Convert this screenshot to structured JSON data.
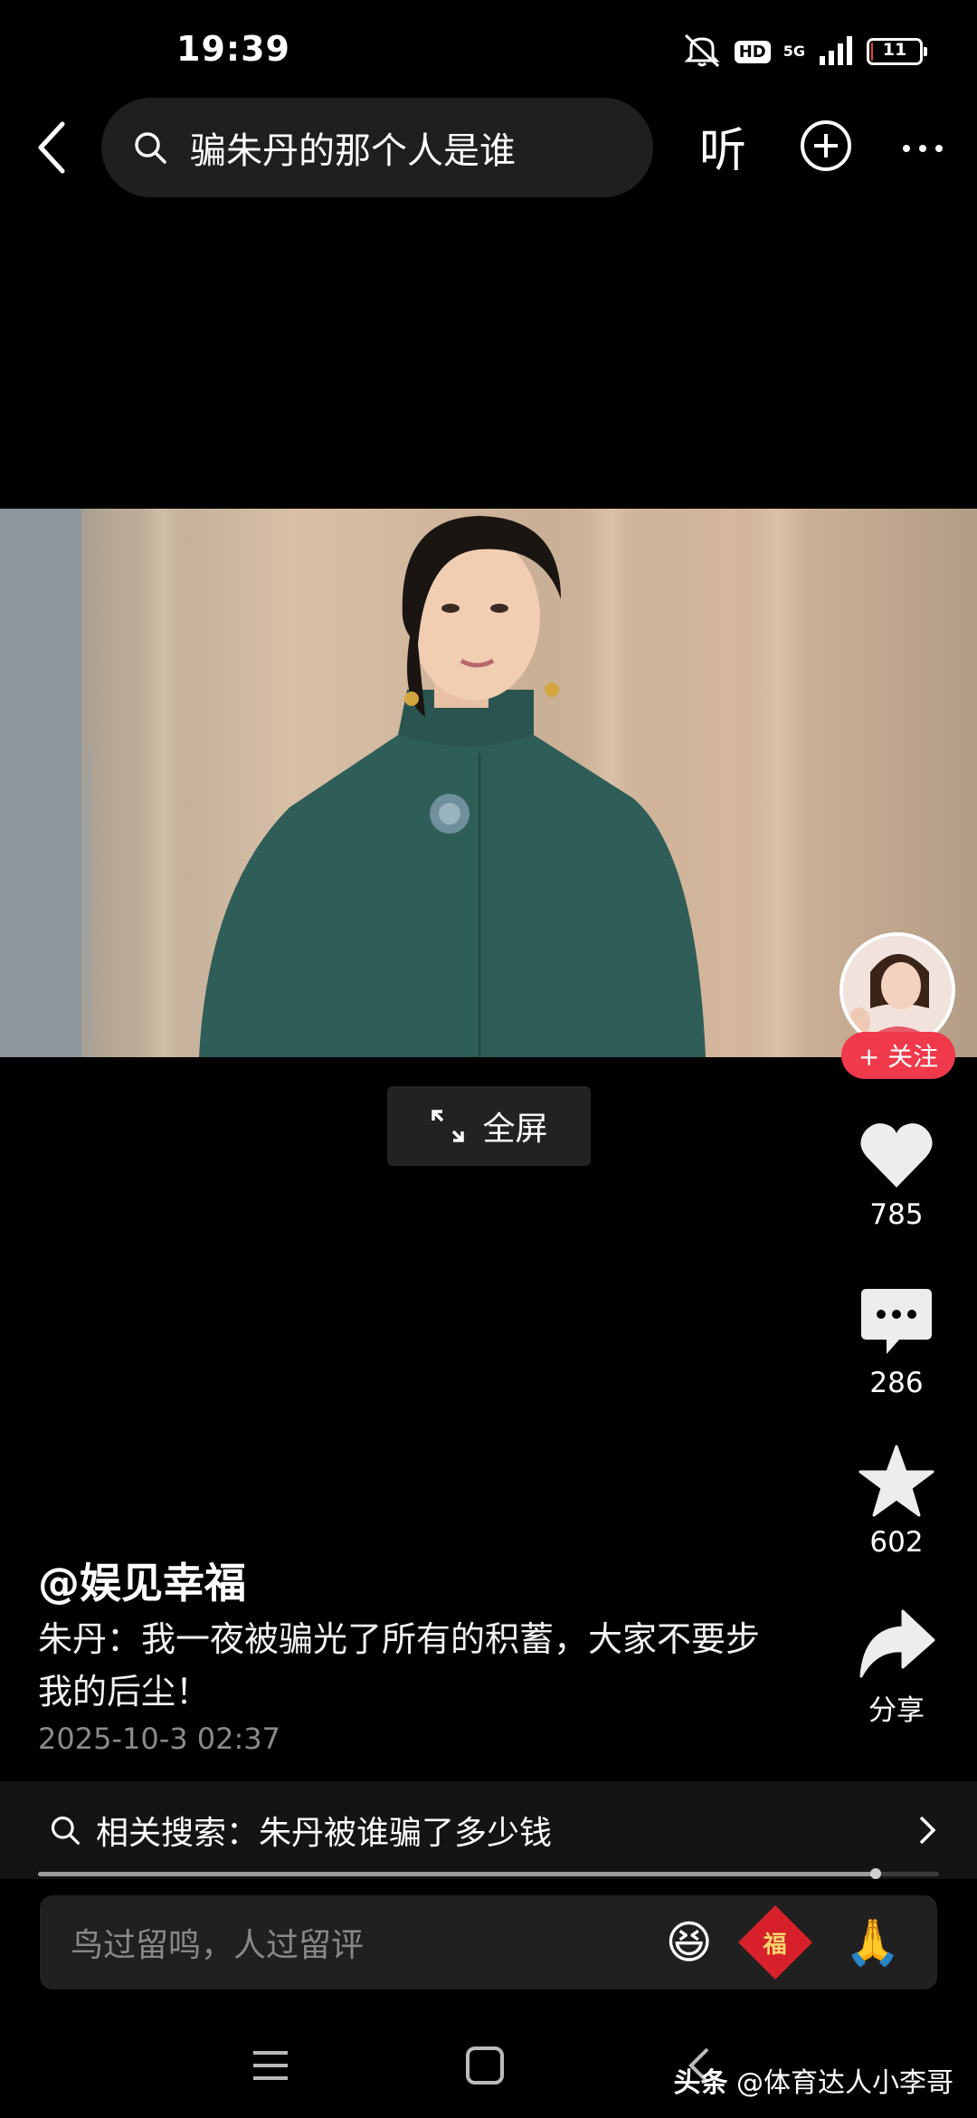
{
  "status_bar": {
    "time": "19:39",
    "hd": "HD",
    "network": "5G",
    "battery": "11",
    "battery_level": 0.11
  },
  "header": {
    "search_query": "骗朱丹的那个人是谁",
    "listen_label": "听"
  },
  "video": {
    "fullscreen_label": "全屏"
  },
  "sidebar": {
    "follow_label": "+ 关注",
    "likes": "785",
    "comments": "286",
    "favorites": "602",
    "share_label": "分享"
  },
  "post": {
    "author": "@娱见幸福",
    "caption": "朱丹：我一夜被骗光了所有的积蓄，大家不要步我的后尘！",
    "date": "2025-10-3 02:37",
    "progress": 0.93
  },
  "related_search": {
    "label": "相关搜索：朱丹被谁骗了多少钱"
  },
  "comment_bar": {
    "placeholder": "鸟过留鸣，人过留评",
    "emoji_laugh": "😆",
    "emoji_fu": "福",
    "emoji_pray": "🙏"
  },
  "watermark": {
    "brand": "头条",
    "handle": "@体育达人小李哥"
  }
}
